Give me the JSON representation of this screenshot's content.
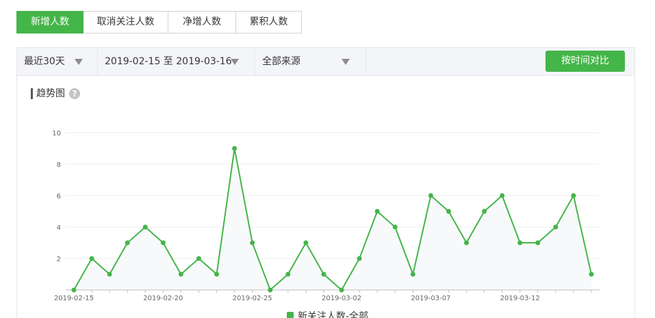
{
  "tabs": [
    {
      "label": "新增人数",
      "active": true
    },
    {
      "label": "取消关注人数",
      "active": false
    },
    {
      "label": "净增人数",
      "active": false
    },
    {
      "label": "累积人数",
      "active": false
    }
  ],
  "filters": {
    "range": "最近30天",
    "dates": "2019-02-15 至 2019-03-16",
    "source": "全部来源",
    "compare_button": "按时间对比"
  },
  "section": {
    "title": "趋势图",
    "help_icon": "question-circle-icon",
    "help_glyph": "?"
  },
  "colors": {
    "accent": "#44b549",
    "line": "#44b549",
    "area": "#f7f9fb"
  },
  "chart_data": {
    "type": "line",
    "ylim": [
      0,
      10
    ],
    "yticks": [
      "2",
      "4",
      "6",
      "8",
      "10"
    ],
    "x": [
      "2019-02-15",
      "2019-02-16",
      "2019-02-17",
      "2019-02-18",
      "2019-02-19",
      "2019-02-20",
      "2019-02-21",
      "2019-02-22",
      "2019-02-23",
      "2019-02-24",
      "2019-02-25",
      "2019-02-26",
      "2019-02-27",
      "2019-02-28",
      "2019-03-01",
      "2019-03-02",
      "2019-03-03",
      "2019-03-04",
      "2019-03-05",
      "2019-03-06",
      "2019-03-07",
      "2019-03-08",
      "2019-03-09",
      "2019-03-10",
      "2019-03-11",
      "2019-03-12",
      "2019-03-13",
      "2019-03-14",
      "2019-03-15",
      "2019-03-16"
    ],
    "xtick_labels": [
      "2019-02-15",
      "2019-02-20",
      "2019-02-25",
      "2019-03-02",
      "2019-03-07",
      "2019-03-12"
    ],
    "series": [
      {
        "name": "新关注人数-全部",
        "values": [
          0,
          2,
          1,
          3,
          4,
          3,
          1,
          2,
          1,
          9,
          3,
          0,
          1,
          3,
          1,
          0,
          2,
          5,
          4,
          1,
          6,
          5,
          3,
          5,
          6,
          3,
          3,
          4,
          6,
          1
        ]
      }
    ],
    "grid": true,
    "legend": "bottom-center"
  }
}
